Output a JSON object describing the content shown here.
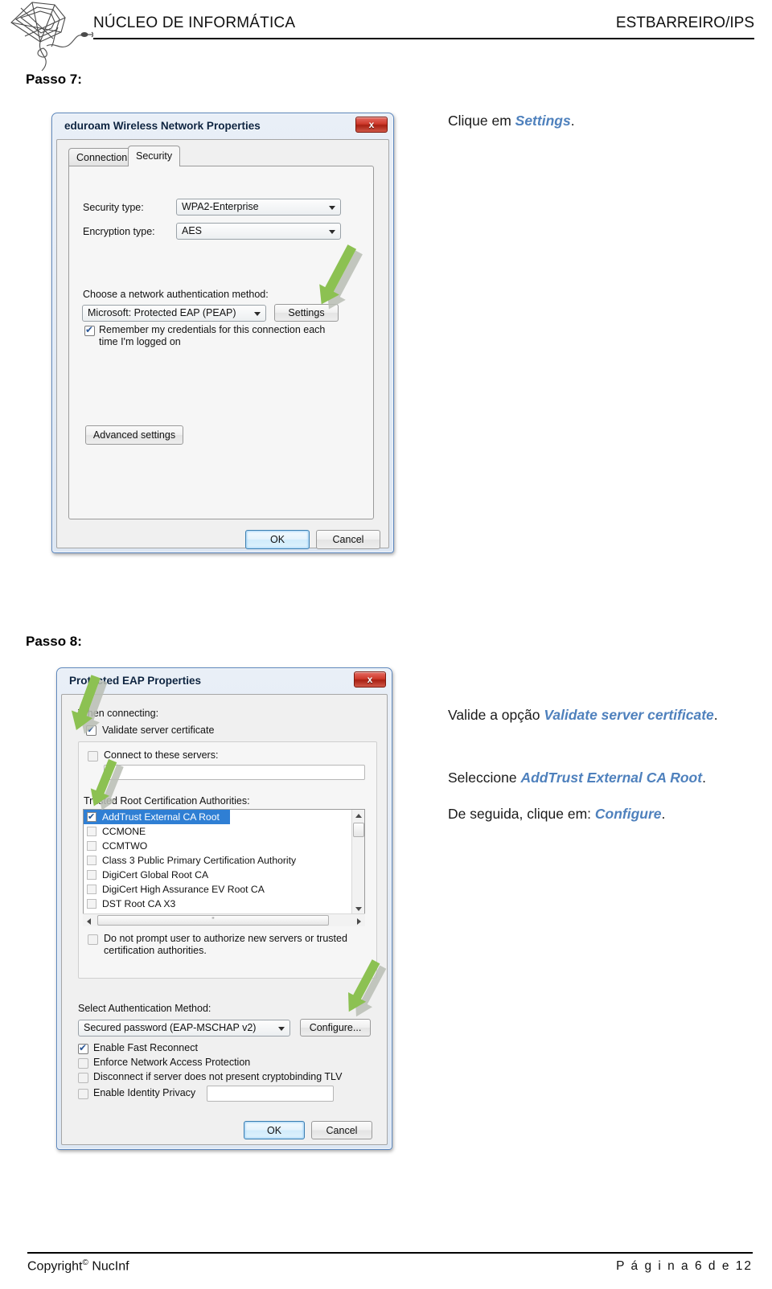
{
  "header": {
    "left_title": "NÚCLEO DE INFORMÁTICA",
    "right_title": "ESTBARREIRO/IPS",
    "logo_name": "spider-web-logo"
  },
  "footer": {
    "copyright": "Copyright",
    "copyright_symbol": "©",
    "owner": "NucInf",
    "page_label": "P á g i n a  6  d e  12"
  },
  "steps": [
    {
      "id": "passo7",
      "title": "Passo 7:",
      "instruction": {
        "prefix": "Clique em ",
        "highlight": "Settings",
        "suffix": "."
      },
      "dialog": {
        "title": "eduroam Wireless Network Properties",
        "close_label": "x",
        "tabs": [
          {
            "label": "Connection",
            "active": false
          },
          {
            "label": "Security",
            "active": true
          }
        ],
        "fields": [
          {
            "label": "Security type:",
            "value": "WPA2-Enterprise"
          },
          {
            "label": "Encryption type:",
            "value": "AES"
          }
        ],
        "auth_method_label": "Choose a network authentication method:",
        "auth_method_value": "Microsoft: Protected EAP (PEAP)",
        "settings_button": "Settings",
        "remember_checkbox": {
          "checked": true,
          "line1": "Remember my credentials for this connection each",
          "line2": "time I'm logged on"
        },
        "advanced_button": "Advanced settings",
        "ok_button": "OK",
        "cancel_button": "Cancel"
      }
    },
    {
      "id": "passo8",
      "title": "Passo 8:",
      "instructions": [
        {
          "prefix": "Valide a opção ",
          "highlight": "Validate server certificate",
          "suffix": "."
        },
        {
          "prefix": "Seleccione ",
          "highlight": "AddTrust External CA Root",
          "suffix": "."
        },
        {
          "prefix": "De seguida, clique em: ",
          "highlight": "Configure",
          "suffix": "."
        }
      ],
      "dialog": {
        "title": "Protected EAP Properties",
        "close_label": "x",
        "when_connecting_label": "When connecting:",
        "validate_server_certificate": {
          "label": "Validate server certificate",
          "checked": true
        },
        "connect_to_servers": {
          "label": "Connect to these servers:",
          "checked": false,
          "value": ""
        },
        "trusted_roots_label": "Trusted Root Certification Authorities:",
        "cert_list": [
          {
            "name": "AddTrust External CA Root",
            "checked": true,
            "selected": true
          },
          {
            "name": "CCMONE",
            "checked": false,
            "selected": false
          },
          {
            "name": "CCMTWO",
            "checked": false,
            "selected": false
          },
          {
            "name": "Class 3 Public Primary Certification Authority",
            "checked": false,
            "selected": false
          },
          {
            "name": "DigiCert Global Root CA",
            "checked": false,
            "selected": false
          },
          {
            "name": "DigiCert High Assurance EV Root CA",
            "checked": false,
            "selected": false
          },
          {
            "name": "DST Root CA X3",
            "checked": false,
            "selected": false
          }
        ],
        "hscroll_glyph": "\"",
        "do_not_prompt": {
          "checked": false,
          "line1": "Do not prompt user to authorize new servers or trusted",
          "line2": "certification authorities."
        },
        "select_auth_label": "Select Authentication Method:",
        "select_auth_value": "Secured password (EAP-MSCHAP v2)",
        "configure_button": "Configure...",
        "options": [
          {
            "label": "Enable Fast Reconnect",
            "checked": true
          },
          {
            "label": "Enforce Network Access Protection",
            "checked": false
          },
          {
            "label": "Disconnect if server does not present cryptobinding TLV",
            "checked": false
          },
          {
            "label": "Enable Identity Privacy",
            "checked": false
          }
        ],
        "identity_privacy_value": "",
        "ok_button": "OK",
        "cancel_button": "Cancel"
      }
    }
  ],
  "colors": {
    "highlight_blue": "#4f81bd",
    "arrow_green": "#8cc152",
    "selection_blue": "#2f7fd4",
    "close_red": "#cf3a2c"
  }
}
